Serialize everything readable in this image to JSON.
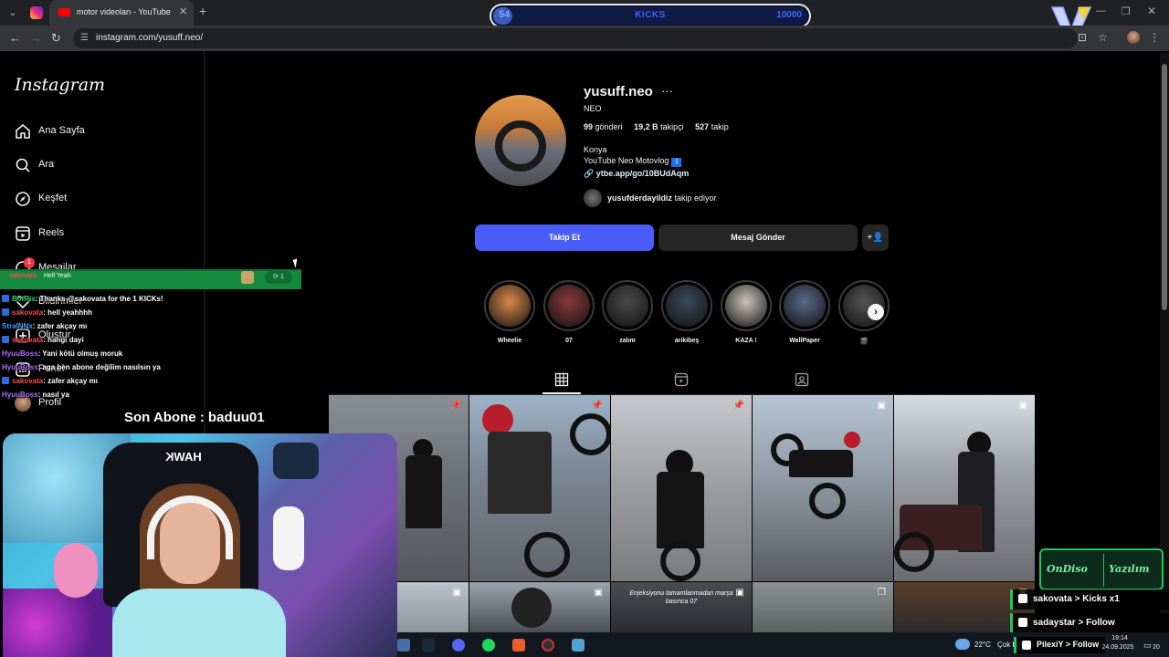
{
  "browser": {
    "tab_title": "motor videoları - YouTube",
    "url": "instagram.com/yusuff.neo/"
  },
  "kicks_goal": {
    "current": "54",
    "label": "KICKS",
    "target": "10000",
    "progress": 0.0054
  },
  "sidebar": {
    "logo": "Instagram",
    "items": [
      {
        "label": "Ana Sayfa",
        "icon": "home-icon"
      },
      {
        "label": "Ara",
        "icon": "search-icon"
      },
      {
        "label": "Keşfet",
        "icon": "compass-icon"
      },
      {
        "label": "Reels",
        "icon": "reels-icon"
      },
      {
        "label": "Mesajlar",
        "icon": "messenger-icon",
        "badge": "1"
      },
      {
        "label": "Bildirimler",
        "icon": "heart-icon"
      },
      {
        "label": "Oluştur",
        "icon": "plus-square-icon"
      },
      {
        "label": "Panel",
        "icon": "dashboard-icon"
      },
      {
        "label": "Profil",
        "icon": "avatar"
      }
    ]
  },
  "profile": {
    "username": "yusuff.neo",
    "full_name": "NEO",
    "posts": "99",
    "posts_label": "gönderi",
    "followers": "19,2 B",
    "followers_label": "takipçi",
    "following": "527",
    "following_label": "takip",
    "bio_line1": "Konya",
    "bio_line2": "YouTube Neo Motovlog",
    "bio_badge": "1",
    "link": "ytbe.app/go/10BUdAqm",
    "followed_by_user": "yusufderdayildiz",
    "followed_by_text": "takip ediyor",
    "follow_button": "Takip Et",
    "message_button": "Mesaj Gönder"
  },
  "highlights": [
    {
      "label": "Wheelie",
      "color": "#d9894a"
    },
    {
      "label": "07",
      "color": "#8a3a3a"
    },
    {
      "label": "zalım",
      "color": "#4a4a4a"
    },
    {
      "label": "arikibeş",
      "color": "#3a4a5a"
    },
    {
      "label": "KAZA !",
      "color": "#c9c2b8"
    },
    {
      "label": "WallPaper",
      "color": "#5a6a8a"
    },
    {
      "label": "🎬",
      "color": "#555555"
    }
  ],
  "posts_grid": {
    "caption_post": "Enjeksiyonu tamamlanmadan marşa basınca 07"
  },
  "stream": {
    "alert": {
      "user": "sakovata",
      "message": "Hell Yeah",
      "count": "1"
    },
    "chat": [
      {
        "user": "BotRix",
        "color": "#1fd65f",
        "message": ": Thanks @sakovata for the 1 KICKs!"
      },
      {
        "user": "sakovata",
        "color": "#ff4b4b",
        "message": ": hell yeahhhh"
      },
      {
        "user": "StralNNx",
        "color": "#4a9cff",
        "message": ": zafer akçay mı"
      },
      {
        "user": "sakovata",
        "color": "#ff4b4b",
        "message": ": hangi dayi"
      },
      {
        "user": "HyuuBoss",
        "color": "#b36bff",
        "message": ": Yani kötü olmuş moruk"
      },
      {
        "user": "HyuuBoss",
        "color": "#b36bff",
        "message": ": aga ben abone değilim nasılsın ya"
      },
      {
        "user": "sakovata",
        "color": "#ff4b4b",
        "message": ": zafer akçay mı"
      },
      {
        "user": "HyuuBoss",
        "color": "#b36bff",
        "message": ": nasıl ya"
      }
    ],
    "last_sub": "Son Abone : baduu01",
    "brand_left": "OnDiso",
    "brand_right": "Yazılım",
    "events": [
      {
        "text": "sakovata > Kicks x1"
      },
      {
        "text": "sadaystar > Follow"
      },
      {
        "text": "PilexiY > Follow"
      }
    ],
    "webcam_text": "HAWK"
  },
  "taskbar": {
    "temperature": "22°C",
    "weather": "Çok bulutlu",
    "time": "19:14",
    "date": "24.09.2025",
    "notif_count": "20"
  },
  "colors": {
    "follow_blue": "#4a5df9",
    "kick_green": "#22c55e",
    "ig_bg": "#000000"
  }
}
